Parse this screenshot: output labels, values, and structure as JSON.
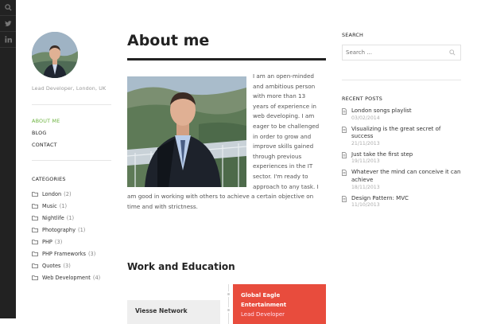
{
  "social": {
    "items": [
      {
        "name": "search-icon"
      },
      {
        "name": "twitter-icon"
      },
      {
        "name": "linkedin-icon"
      }
    ]
  },
  "profile": {
    "tagline": "Lead Developer, London, UK"
  },
  "nav": {
    "items": [
      {
        "label": "ABOUT ME",
        "active": true
      },
      {
        "label": "BLOG",
        "active": false
      },
      {
        "label": "CONTACT",
        "active": false
      }
    ]
  },
  "categories": {
    "title": "CATEGORIES",
    "items": [
      {
        "label": "London",
        "count": "(2)"
      },
      {
        "label": "Music",
        "count": "(1)"
      },
      {
        "label": "Nightlife",
        "count": "(1)"
      },
      {
        "label": "Photography",
        "count": "(1)"
      },
      {
        "label": "PHP",
        "count": "(3)"
      },
      {
        "label": "PHP Frameworks",
        "count": "(3)"
      },
      {
        "label": "Quotes",
        "count": "(3)"
      },
      {
        "label": "Web Development",
        "count": "(4)"
      }
    ]
  },
  "main": {
    "title": "About me",
    "intro": "I am an open-minded and ambitious person with more than 13 years of experience in web developing. I am eager to be challenged in order to grow and improve skills gained through previous experiences in the IT sector. I'm ready to approach to any task. I am good in working with others to achieve a certain objective on time and with strictness.",
    "section_title": "Work and Education",
    "timeline": {
      "red_card": {
        "title_line1": "Global Eagle",
        "title_line2": "Entertainment",
        "subtitle": "Lead Developer"
      },
      "gray_card": {
        "title": "Viesse Network"
      }
    }
  },
  "search": {
    "title": "SEARCH",
    "placeholder": "Search ..."
  },
  "recent_posts": {
    "title": "RECENT POSTS",
    "items": [
      {
        "title": "London songs playlist",
        "date": "03/02/2014"
      },
      {
        "title": "Visualizing is the great secret of success",
        "date": "21/11/2013"
      },
      {
        "title": "Just take the first step",
        "date": "19/11/2013"
      },
      {
        "title": "Whatever the mind can conceive it can achieve",
        "date": "18/11/2013"
      },
      {
        "title": "Design Pattern: MVC",
        "date": "11/10/2013"
      }
    ]
  },
  "colors": {
    "accent_green": "#6cb33f",
    "accent_red": "#e84c3d",
    "rail": "#222222"
  }
}
